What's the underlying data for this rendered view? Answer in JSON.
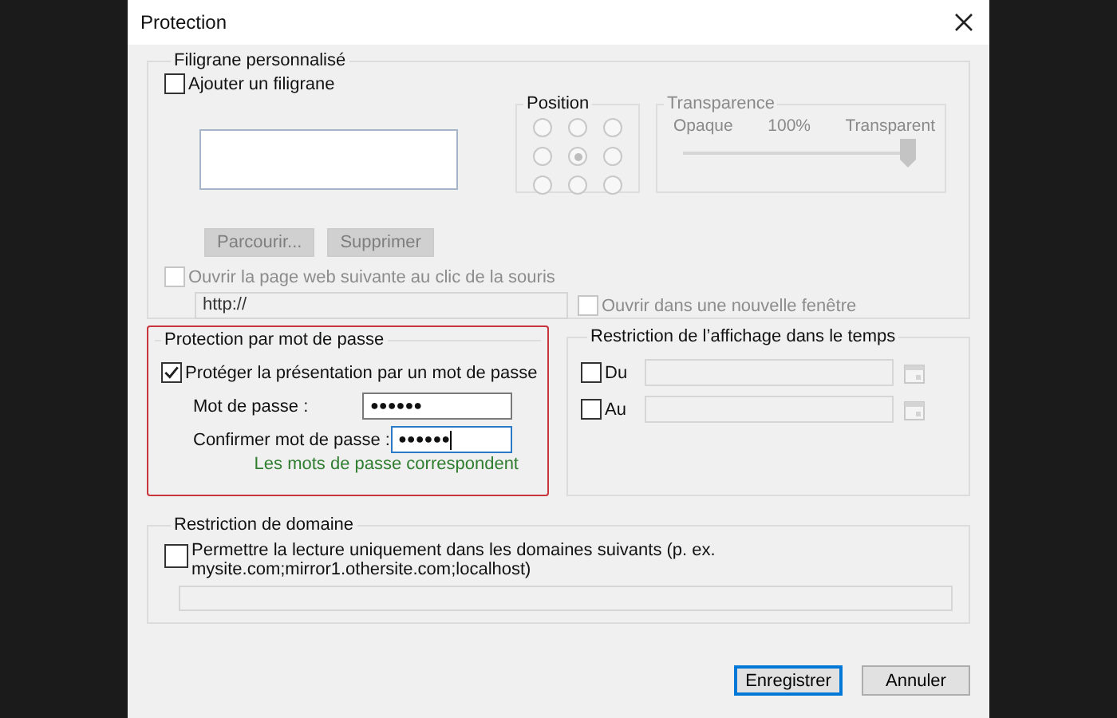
{
  "window": {
    "title": "Protection"
  },
  "watermark": {
    "title": "Filigrane personnalisé",
    "add": {
      "label": "Ajouter un filigrane",
      "checked": false
    },
    "position": {
      "title": "Position",
      "options": [
        {
          "selected": false
        },
        {
          "selected": false
        },
        {
          "selected": false
        },
        {
          "selected": false
        },
        {
          "selected": true
        },
        {
          "selected": false
        },
        {
          "selected": false
        },
        {
          "selected": false
        },
        {
          "selected": false
        }
      ]
    },
    "transparency": {
      "title": "Transparence",
      "min_label": "Opaque",
      "value_label": "100%",
      "max_label": "Transparent",
      "level": 1.0,
      "disabled": true
    },
    "buttons": [
      {
        "label": "Parcourir...",
        "disabled": true
      },
      {
        "label": "Supprimer",
        "disabled": true
      }
    ],
    "open_link": {
      "label": "Ouvrir la page web suivante au clic de la souris",
      "checked": false,
      "disabled": true
    },
    "url": {
      "value": "http://",
      "disabled": true
    },
    "new_window": {
      "label": "Ouvrir dans une nouvelle fenêtre",
      "checked": false,
      "disabled": true
    }
  },
  "password": {
    "title": "Protection par mot de passe",
    "protect": {
      "label": "Protéger la présentation par un mot de passe",
      "checked": true
    },
    "fields": [
      {
        "label": "Mot de passe :",
        "value": "●●●●●●",
        "focused": false
      },
      {
        "label": "Confirmer mot de passe :",
        "value": "●●●●●●",
        "focused": true
      }
    ],
    "message": "Les mots de passe correspondent"
  },
  "time_restriction": {
    "title": "Restriction de l’affichage dans le temps",
    "items": [
      {
        "label": "Du",
        "checked": false
      },
      {
        "label": "Au",
        "checked": false
      }
    ]
  },
  "domain": {
    "title": "Restriction de domaine",
    "checkbox": {
      "label": "Permettre la lecture uniquement dans les domaines suivants (p. ex. mysite.com;mirror1.othersite.com;localhost)",
      "checked": false
    }
  },
  "buttons": [
    {
      "label": "Enregistrer",
      "default": true
    },
    {
      "label": "Annuler",
      "default": false
    }
  ]
}
